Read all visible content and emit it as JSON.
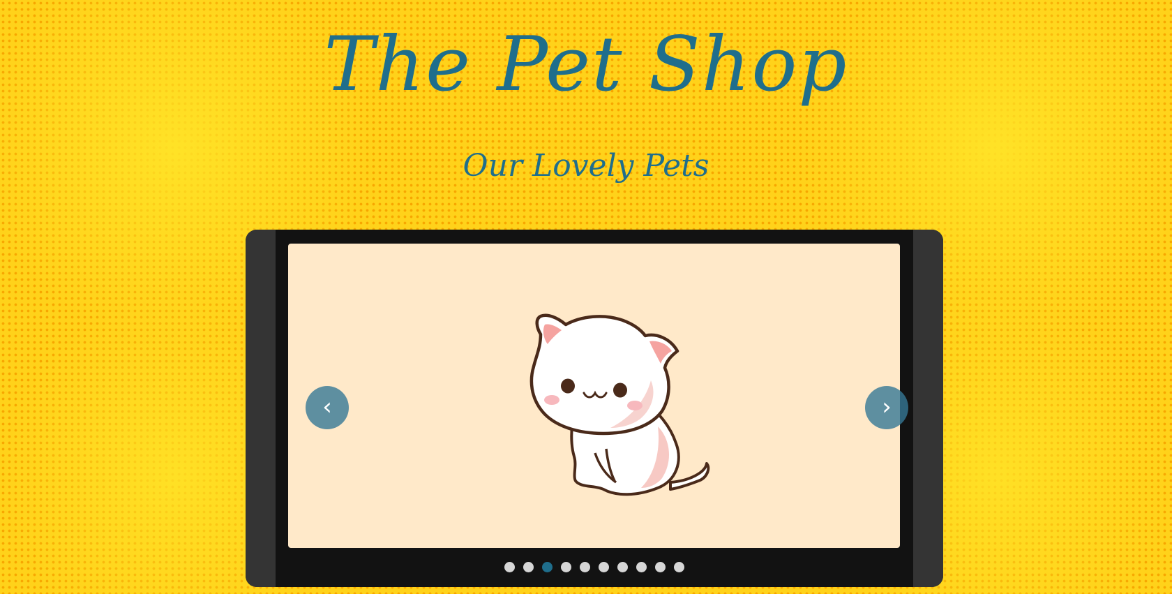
{
  "header": {
    "title": "The Pet Shop",
    "subtitle": "Our Lovely Pets"
  },
  "carousel": {
    "prev_label": "‹",
    "next_label": "›",
    "slide_count": 10,
    "active_index": 2,
    "current_slide": {
      "subject": "white-kitten-cartoon",
      "background_color": "#ffe9c9"
    }
  },
  "colors": {
    "title": "#1f6e8c",
    "frame": "#121212",
    "frame_side": "#343434",
    "dot": "#d6d6d6",
    "dot_active": "#1f6e8c",
    "page_background": "#ffd21a"
  }
}
